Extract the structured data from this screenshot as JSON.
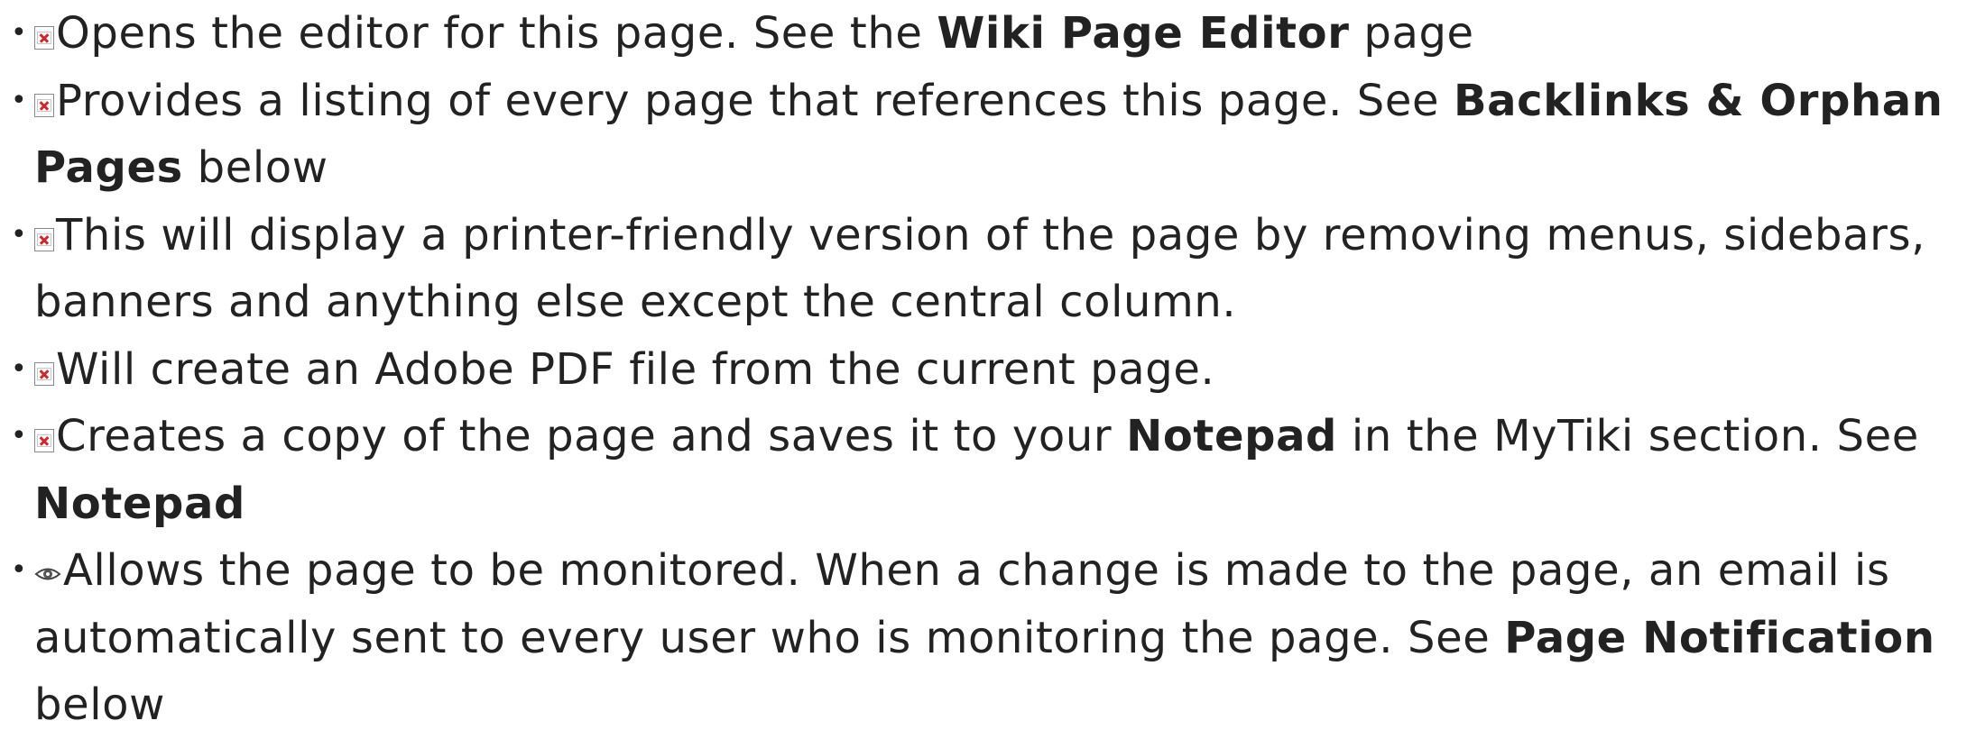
{
  "items": [
    {
      "icon": "broken-image-icon",
      "parts": [
        "Opens the editor for this page. See the ",
        "Wiki Page Editor",
        " page"
      ]
    },
    {
      "icon": "broken-image-icon",
      "parts": [
        "Provides a listing of every page that references this page. See ",
        "Backlinks & Orphan Pages",
        " below"
      ]
    },
    {
      "icon": "broken-image-icon",
      "parts": [
        "This will display a printer-friendly version of the page by removing menus, sidebars, banners and anything else except the central column."
      ]
    },
    {
      "icon": "broken-image-icon",
      "parts": [
        "Will create an Adobe PDF file from the current page."
      ]
    },
    {
      "icon": "broken-image-icon",
      "parts": [
        "Creates a copy of the page and saves it to your ",
        "Notepad",
        " in the MyTiki section. See ",
        "Notepad"
      ]
    },
    {
      "icon": "eye-icon",
      "parts": [
        "Allows the page to be monitored. When a change is made to the page, an email is automatically sent to every user who is monitoring the page. See ",
        "Page Notification",
        " below"
      ]
    }
  ],
  "bullet_char": "•"
}
